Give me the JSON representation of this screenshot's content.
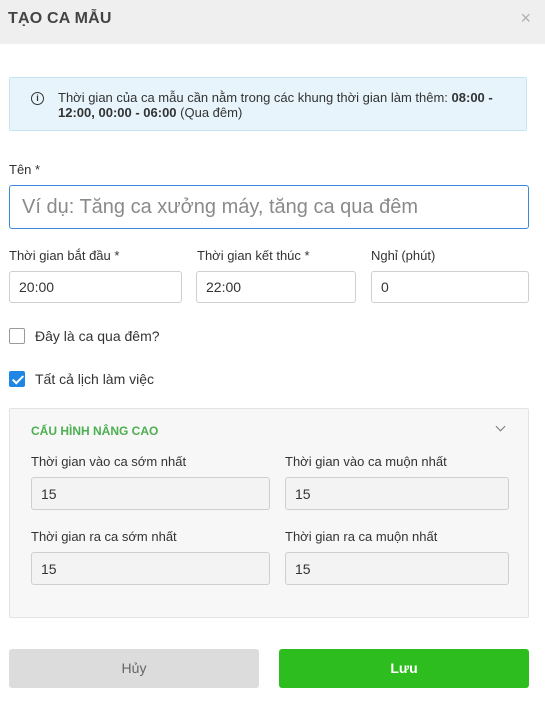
{
  "dialog": {
    "title": "TẠO CA MẪU",
    "close_glyph": "×"
  },
  "info": {
    "text_prefix": "Thời gian của ca mẫu cần nằm trong các khung thời gian làm thêm: ",
    "ranges_part1": "08:00 - 12:00",
    "separator": ", ",
    "ranges_part2": "00:00 - 06:00",
    "suffix": " (Qua đêm)"
  },
  "name_field": {
    "label": "Tên *",
    "value": "",
    "placeholder": "Ví dụ: Tăng ca xưởng máy, tăng ca qua đêm"
  },
  "time": {
    "start_label": "Thời gian bắt đầu *",
    "start_value": "20:00",
    "end_label": "Thời gian kết thúc *",
    "end_value": "22:00",
    "break_label": "Nghỉ (phút)",
    "break_value": "0"
  },
  "checkboxes": {
    "overnight_label": "Đây là ca qua đêm?",
    "overnight_checked": false,
    "all_schedules_label": "Tất cả lịch làm việc",
    "all_schedules_checked": true
  },
  "advanced": {
    "title": "CẤU HÌNH NÂNG CAO",
    "earliest_in_label": "Thời gian vào ca sớm nhất",
    "earliest_in_value": "15",
    "latest_in_label": "Thời gian vào ca muộn nhất",
    "latest_in_value": "15",
    "earliest_out_label": "Thời gian ra ca sớm nhất",
    "earliest_out_value": "15",
    "latest_out_label": "Thời gian ra ca muộn nhất",
    "latest_out_value": "15"
  },
  "buttons": {
    "cancel": "Hủy",
    "save": "Lưu"
  },
  "colors": {
    "accent_blue": "#1f86e6",
    "save_green": "#2ebd1e",
    "advanced_title_green": "#4caf50",
    "info_background": "#e7f4fb"
  }
}
